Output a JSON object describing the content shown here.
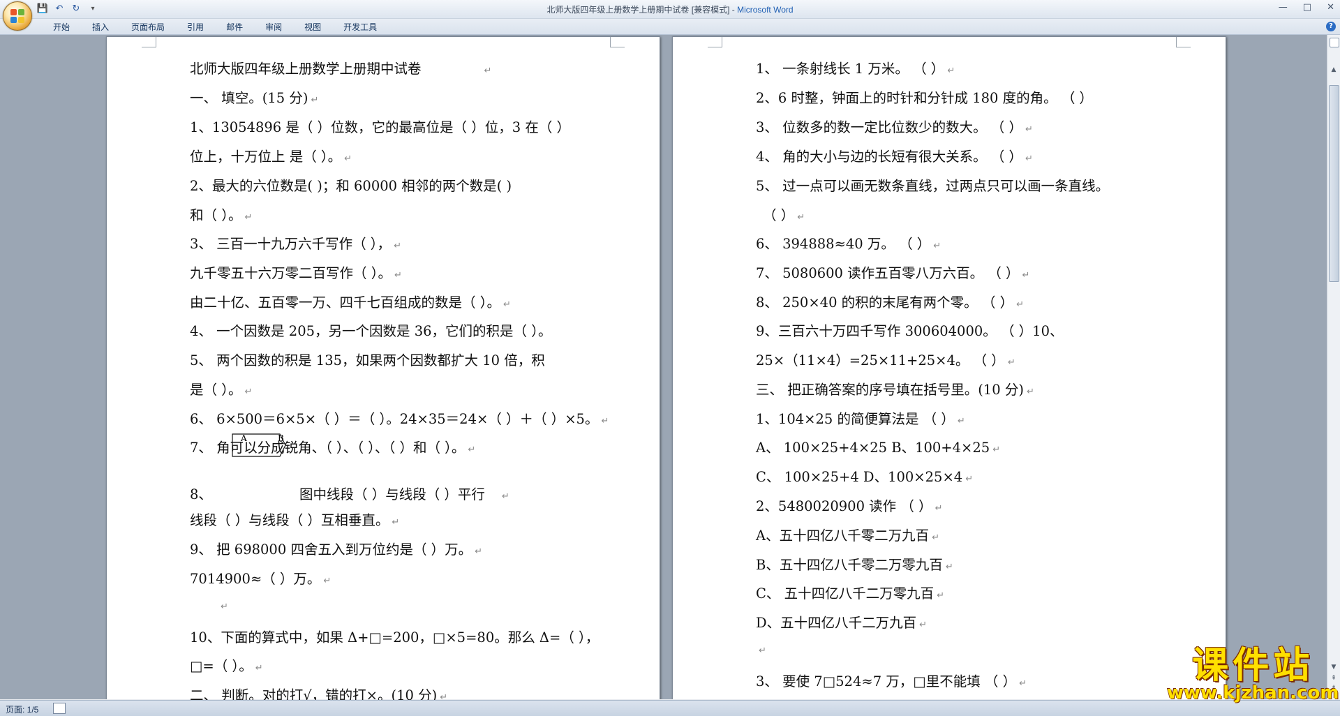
{
  "window": {
    "title": "北师大版四年级上册数学上册期中试卷 [兼容模式] - ",
    "app_name": "Microsoft Word",
    "controls": [
      "—",
      "□",
      "✕"
    ]
  },
  "qat": {
    "save_icon": "💾",
    "undo_icon": "↶",
    "redo_icon": "↻",
    "customize_icon": "▾"
  },
  "ribbon": {
    "tabs": [
      "开始",
      "插入",
      "页面布局",
      "引用",
      "邮件",
      "审阅",
      "视图",
      "开发工具"
    ],
    "help": "?"
  },
  "left_page": {
    "lines": [
      "北师大版四年级上册数学上册期中试卷",
      "  一、  填空。(15 分)",
      "1、13054896 是（ ）位数，它的最高位是（ ）位，3 在（ ）",
      "位上，十万位上    是（ ）。",
      "  2、最大的六位数是(      )；和 60000 相邻的两个数是(      )",
      "和（     ）。",
      "  3、  三百一十九万六千写作（          ），",
      "九千零五十六万零二百写作（          ）。",
      "由二十亿、五百零一万、四千七百组成的数是（          ）。",
      "4、  一个因数是 205，另一个因数是 36，它们的积是（     ）。",
      "5、  两个因数的积是 135，如果两个因数都扩大 10 倍，积",
      "是（     ）。",
      "6、  6×500＝6×5×（ ）＝（ ）。24×35＝24×（ ）＋（ ）×5。",
      "  7、    角可以分成锐角、（     ）、（     ）、（     ）和（     ）。",
      "  8、",
      "图中线段（ ）与线段（ ）平行",
      "      线段（ ）与线段（ ）互相垂直。",
      "  9、    把 698000 四舍五入到万位约是（ ）万。",
      "      7014900≈（ ）万。",
      "",
      "  10、下面的算式中，如果 Δ+□=200，□×5=80。那么 Δ=（ ），",
      "□=（ ）。",
      "  二、  判断。对的打√，错的打×。(10 分)"
    ],
    "shape_labels": [
      "A",
      "B"
    ]
  },
  "right_page": {
    "lines": [
      "  1、   一条射线长 1 万米。                           （ ）",
      "  2、6 时整，钟面上的时针和分针成 180 度的角。           （ ）",
      "  3、   位数多的数一定比位数少的数大。                   （ ）",
      "  4、   角的大小与边的长短有很大关系。                   （ ）",
      "  5、   过一点可以画无数条直线，过两点只可以画一条直线。",
      "（ ）",
      "6、   394888≈40 万。                              （ ）",
      "7、   5080600 读作五百零八万六百。                      （ ）",
      "8、   250×40 的积的末尾有两个零。                       （ ）",
      "9、三百六十万四千写作 300604000。                （ ）10、",
      "25×（11×4）=25×11+25×4。                 （ ）",
      "  三、   把正确答案的序号填在括号里。(10 分)",
      "  1、104×25 的简便算法是                       （ ）",
      "A、  100×25+4×25          B、100+4×25",
      "C、  100×25+4             D、100×25×4",
      "2、5480020900 读作                            （ ）",
      "A、五十四亿八千零二万九百",
      " B、五十四亿八千零二万零九百",
      "  C、   五十四亿八千二万零九百",
      "   D、五十四亿八千二万九百",
      "",
      "  3、   要使 7□524≈7 万，□里不能填                    （ ）"
    ]
  },
  "statusbar": {
    "page_info": "页面: 1/5"
  },
  "watermark": {
    "main": "课件站",
    "url": "www.kjzhan.com"
  }
}
